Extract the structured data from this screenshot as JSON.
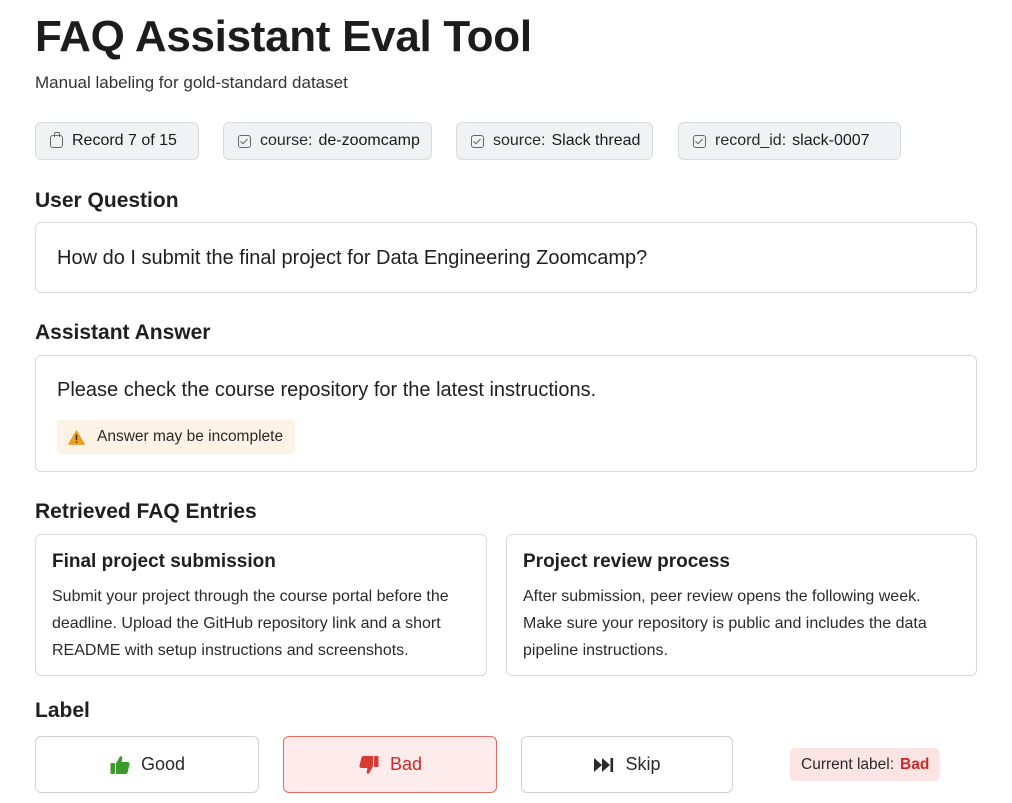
{
  "app": {
    "title": "FAQ Assistant Eval Tool",
    "subtitle": "Manual labeling for gold-standard dataset"
  },
  "meta_chips": [
    {
      "icon": "clipboard-icon",
      "key": "",
      "value": "Record 7 of 15"
    },
    {
      "icon": "checkbox-icon",
      "key": "course:",
      "value": "de-zoomcamp"
    },
    {
      "icon": "checkbox-icon",
      "key": "source:",
      "value": "Slack thread"
    },
    {
      "icon": "checkbox-icon",
      "key": "record_id:",
      "value": "slack-0007"
    }
  ],
  "question": {
    "heading": "User Question",
    "text": "How do I submit the final project for Data Engineering Zoomcamp?"
  },
  "answer": {
    "heading": "Assistant Answer",
    "text": "Please check the course repository for the latest instructions.",
    "warning": "Answer may be incomplete",
    "warning_icon": "warning-icon"
  },
  "faq": {
    "heading": "Retrieved FAQ Entries",
    "entries": [
      {
        "title": "Final project submission",
        "body": "Submit your project through the course portal before the deadline. Upload the GitHub repository link and a short README with setup instructions and screenshots."
      },
      {
        "title": "Project review process",
        "body": "After submission, peer review opens the following week. Make sure your repository is public and includes the data pipeline instructions."
      }
    ]
  },
  "label": {
    "heading": "Label",
    "buttons": {
      "good": "Good",
      "bad": "Bad",
      "skip": "Skip"
    },
    "current_prefix": "Current label:",
    "current_value": "Bad"
  },
  "colors": {
    "accent_bad": "#cc2a26",
    "bad_bg": "#fdeceb",
    "good_green": "#3a9a2a",
    "warning_bg": "#fdf2e6",
    "warning_icon": "#f0a21a"
  }
}
